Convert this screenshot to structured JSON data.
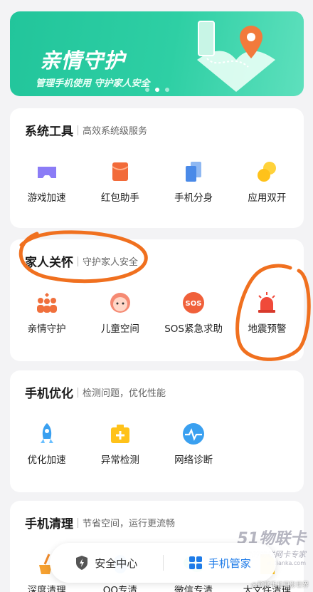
{
  "banner": {
    "title": "亲情守护",
    "subtitle": "管理手机使用 守护家人安全",
    "dots": 3,
    "active_dot": 0
  },
  "sections": [
    {
      "title": "系统工具",
      "subtitle": "高效系统级服务",
      "items": [
        {
          "label": "游戏加速",
          "icon": "gamepad-icon"
        },
        {
          "label": "红包助手",
          "icon": "red-packet-icon"
        },
        {
          "label": "手机分身",
          "icon": "phone-clone-icon"
        },
        {
          "label": "应用双开",
          "icon": "dual-apps-icon"
        }
      ]
    },
    {
      "title": "家人关怀",
      "subtitle": "守护家人安全",
      "items": [
        {
          "label": "亲情守护",
          "icon": "family-icon"
        },
        {
          "label": "儿童空间",
          "icon": "child-face-icon"
        },
        {
          "label": "SOS紧急求助",
          "icon": "sos-icon"
        },
        {
          "label": "地震预警",
          "icon": "alarm-light-icon"
        }
      ]
    },
    {
      "title": "手机优化",
      "subtitle": "检测问题，优化性能",
      "items": [
        {
          "label": "优化加速",
          "icon": "rocket-icon"
        },
        {
          "label": "异常检测",
          "icon": "first-aid-icon"
        },
        {
          "label": "网络诊断",
          "icon": "network-pulse-icon"
        }
      ]
    },
    {
      "title": "手机清理",
      "subtitle": "节省空间，运行更流畅",
      "items": [
        {
          "label": "深度清理",
          "icon": "broom-icon"
        },
        {
          "label": "QQ专清",
          "icon": "qq-icon"
        },
        {
          "label": "微信专清",
          "icon": "wechat-icon"
        },
        {
          "label": "大文件清理",
          "icon": "file-icon"
        }
      ]
    }
  ],
  "bottom_nav": [
    {
      "label": "安全中心",
      "icon": "shield-icon",
      "active": false
    },
    {
      "label": "手机管家",
      "icon": "grid-icon",
      "active": true
    }
  ],
  "watermark": {
    "logo": "51物联卡",
    "tagline": "您身边的物联网卡专家",
    "url": "wulianka.com",
    "credit": "@聊聊手机摄影世界"
  },
  "colors": {
    "accent": "#1e7be8",
    "banner_green": "#22c59b",
    "scribble": "#f0701f"
  }
}
